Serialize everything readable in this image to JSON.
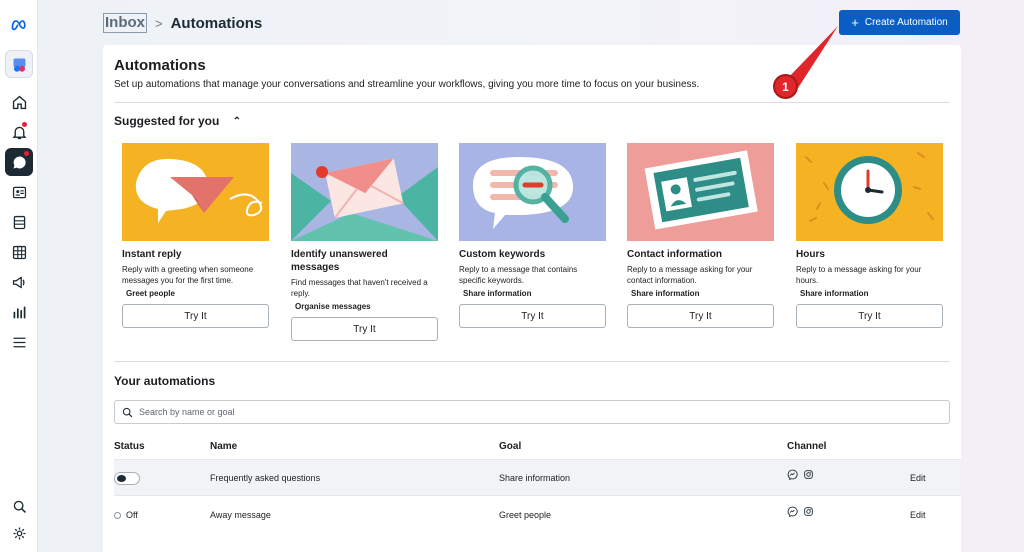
{
  "breadcrumb": {
    "root": "Inbox",
    "separator": ">",
    "current": "Automations"
  },
  "create_button": {
    "label": "Create Automation"
  },
  "callout": {
    "number": "1"
  },
  "page": {
    "title": "Automations",
    "description": "Set up automations that manage your conversations and streamline your workflows, giving you more time to focus on your business."
  },
  "suggested": {
    "title": "Suggested for you",
    "cards": [
      {
        "title": "Instant reply",
        "description": "Reply with a greeting when someone messages you for the first time.",
        "tag": "Greet people",
        "button": "Try It"
      },
      {
        "title": "Identify unanswered messages",
        "description": "Find messages that haven't received a reply.",
        "tag": "Organise messages",
        "button": "Try It"
      },
      {
        "title": "Custom keywords",
        "description": "Reply to a message that contains specific keywords.",
        "tag": "Share information",
        "button": "Try It"
      },
      {
        "title": "Contact information",
        "description": "Reply to a message asking for your contact information.",
        "tag": "Share information",
        "button": "Try It"
      },
      {
        "title": "Hours",
        "description": "Reply to a message asking for your hours.",
        "tag": "Share information",
        "button": "Try It"
      }
    ]
  },
  "your_automations": {
    "title": "Your automations",
    "search_placeholder": "Search by name or goal",
    "columns": {
      "status": "Status",
      "name": "Name",
      "goal": "Goal",
      "channel": "Channel"
    },
    "rows": [
      {
        "status": "",
        "name": "Frequently asked questions",
        "goal": "Share information",
        "edit": "Edit"
      },
      {
        "status": "Off",
        "name": "Away message",
        "goal": "Greet people",
        "edit": "Edit"
      }
    ]
  },
  "colors": {
    "primary": "#0a5dc2",
    "callout": "#e0252b",
    "rail_active": "#1c2b33"
  }
}
